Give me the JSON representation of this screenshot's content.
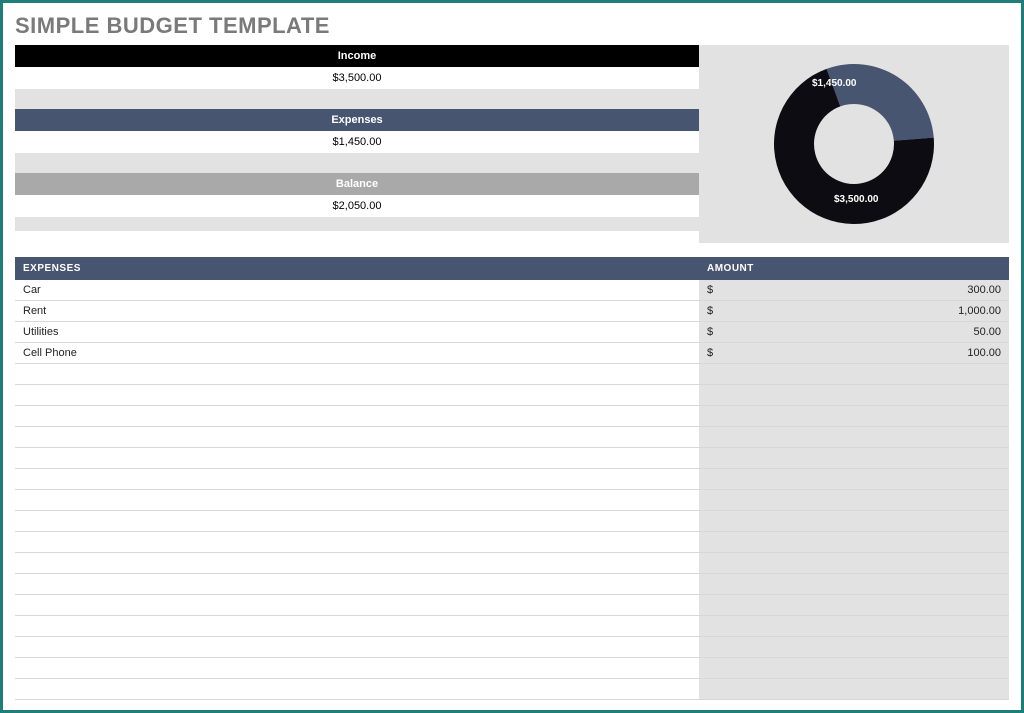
{
  "title": "SIMPLE BUDGET TEMPLATE",
  "summary": {
    "income_label": "Income",
    "income_value": "$3,500.00",
    "expenses_label": "Expenses",
    "expenses_value": "$1,450.00",
    "balance_label": "Balance",
    "balance_value": "$2,050.00"
  },
  "chart_data": {
    "type": "pie",
    "title": "",
    "series": [
      {
        "name": "Expenses",
        "label": "$1,450.00",
        "value": 1450,
        "color": "#475570"
      },
      {
        "name": "Income",
        "label": "$3,500.00",
        "value": 3500,
        "color": "#0c0c12"
      }
    ],
    "donut_inner_ratio": 0.5
  },
  "table": {
    "header_expenses": "EXPENSES",
    "header_amount": "AMOUNT",
    "currency": "$",
    "rows": [
      {
        "name": "Car",
        "amount": "300.00"
      },
      {
        "name": "Rent",
        "amount": "1,000.00"
      },
      {
        "name": "Utilities",
        "amount": "50.00"
      },
      {
        "name": "Cell Phone",
        "amount": "100.00"
      }
    ],
    "empty_rows": 16
  }
}
